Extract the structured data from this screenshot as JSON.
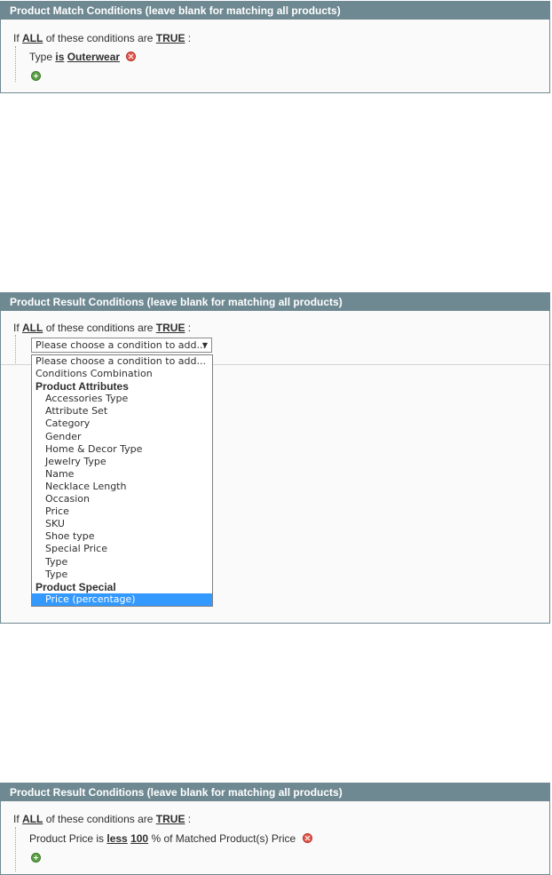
{
  "panel1": {
    "title": "Product Match Conditions (leave blank for matching all products)",
    "if_text": "If",
    "all": "ALL",
    "middle_text": "of these conditions are",
    "true": "TRUE",
    "colon": ":",
    "condition": {
      "attribute": "Type",
      "operator": "is",
      "value": "Outerwear"
    }
  },
  "panel2": {
    "title": "Product Result Conditions (leave blank for matching all products)",
    "if_text": "If",
    "all": "ALL",
    "middle_text": "of these conditions are",
    "true": "TRUE",
    "colon": ":",
    "select_value": "Please choose a condition to add...",
    "dropdown": {
      "placeholder": "Please choose a condition to add...",
      "combination": "Conditions Combination",
      "group1": "Product Attributes",
      "group1_items": [
        "Accessories Type",
        "Attribute Set",
        "Category",
        "Gender",
        "Home & Decor Type",
        "Jewelry Type",
        "Name",
        "Necklace Length",
        "Occasion",
        "Price",
        "SKU",
        "Shoe type",
        "Special Price",
        "Type",
        "Type"
      ],
      "group2": "Product Special",
      "group2_items": [
        "Price (percentage)"
      ],
      "selected": "Price (percentage)"
    }
  },
  "panel3": {
    "title": "Product Result Conditions (leave blank for matching all products)",
    "if_text": "If",
    "all": "ALL",
    "middle_text": "of these conditions are",
    "true": "TRUE",
    "colon": ":",
    "condition": {
      "prefix": "Product Price is",
      "operator": "less",
      "value": "100",
      "suffix": "% of Matched Product(s) Price"
    }
  },
  "icons": {
    "remove": "remove-icon",
    "add": "add-icon"
  },
  "colors": {
    "header_bg": "#6f8992",
    "selected_bg": "#3399ff",
    "remove": "#e25a4e",
    "add": "#5ea14a"
  }
}
